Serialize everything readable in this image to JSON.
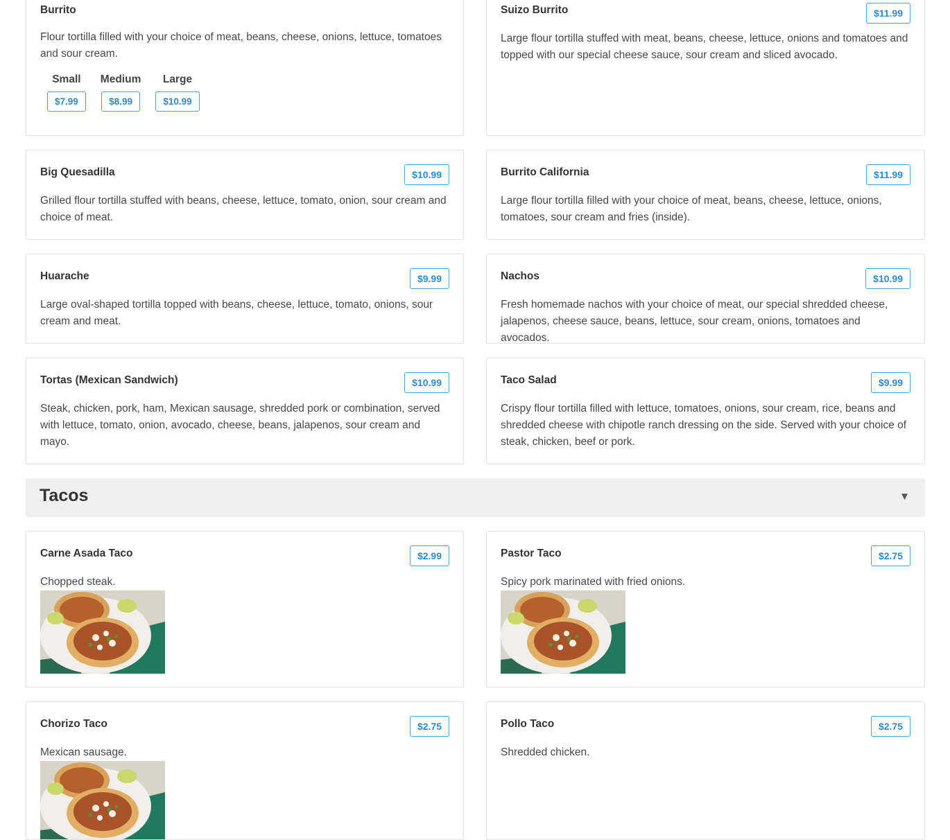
{
  "items_top": [
    {
      "name": "Burrito",
      "description": "Flour tortilla filled with your choice of meat, beans, cheese, onions, lettuce, tomatoes and sour cream.",
      "sizes": [
        {
          "label": "Small",
          "price": "$7.99"
        },
        {
          "label": "Medium",
          "price": "$8.99"
        },
        {
          "label": "Large",
          "price": "$10.99"
        }
      ]
    },
    {
      "name": "Suizo Burrito",
      "price": "$11.99",
      "description": "Large flour tortilla stuffed with meat, beans, cheese, lettuce, onions and tomatoes and topped with our special cheese sauce, sour cream and sliced avocado."
    },
    {
      "name": "Big Quesadilla",
      "price": "$10.99",
      "description": "Grilled flour tortilla stuffed with beans, cheese, lettuce, tomato, onion, sour cream and choice of meat."
    },
    {
      "name": "Burrito California",
      "price": "$11.99",
      "description": "Large flour tortilla filled with your choice of meat, beans, cheese, lettuce, onions, tomatoes, sour cream and fries (inside)."
    },
    {
      "name": "Huarache",
      "price": "$9.99",
      "description": "Large oval-shaped tortilla topped with beans, cheese, lettuce, tomato, onions, sour cream and meat."
    },
    {
      "name": "Nachos",
      "price": "$10.99",
      "description": "Fresh homemade nachos with your choice of meat, our special shredded cheese, jalapenos, cheese sauce, beans, lettuce, sour cream, onions, tomatoes and avocados."
    },
    {
      "name": "Tortas (Mexican Sandwich)",
      "price": "$10.99",
      "description": "Steak, chicken, pork, ham, Mexican sausage, shredded pork or combination, served with lettuce, tomato, onion, avocado, cheese, beans, jalapenos, sour cream and mayo."
    },
    {
      "name": "Taco Salad",
      "price": "$9.99",
      "description": "Crispy flour tortilla filled with lettuce, tomatoes, onions, sour cream, rice, beans and shredded cheese with chipotle ranch dressing on the side. Served with your choice of steak, chicken, beef or pork."
    }
  ],
  "tacos_section": {
    "title": "Tacos",
    "chevron": "▼",
    "items": [
      {
        "name": "Carne Asada Taco",
        "price": "$2.99",
        "description": "Chopped steak.",
        "image": "tacos-photo"
      },
      {
        "name": "Pastor Taco",
        "price": "$2.75",
        "description": "Spicy pork marinated with fried onions.",
        "image": "tacos-photo"
      },
      {
        "name": "Chorizo Taco",
        "price": "$2.75",
        "description": "Mexican sausage.",
        "image": "tacos-photo"
      },
      {
        "name": "Pollo Taco",
        "price": "$2.75",
        "description": "Shredded chicken."
      }
    ]
  },
  "colors": {
    "accent": "#2f8bc3",
    "section_bg": "#efefef",
    "border": "#e4e4e4"
  }
}
